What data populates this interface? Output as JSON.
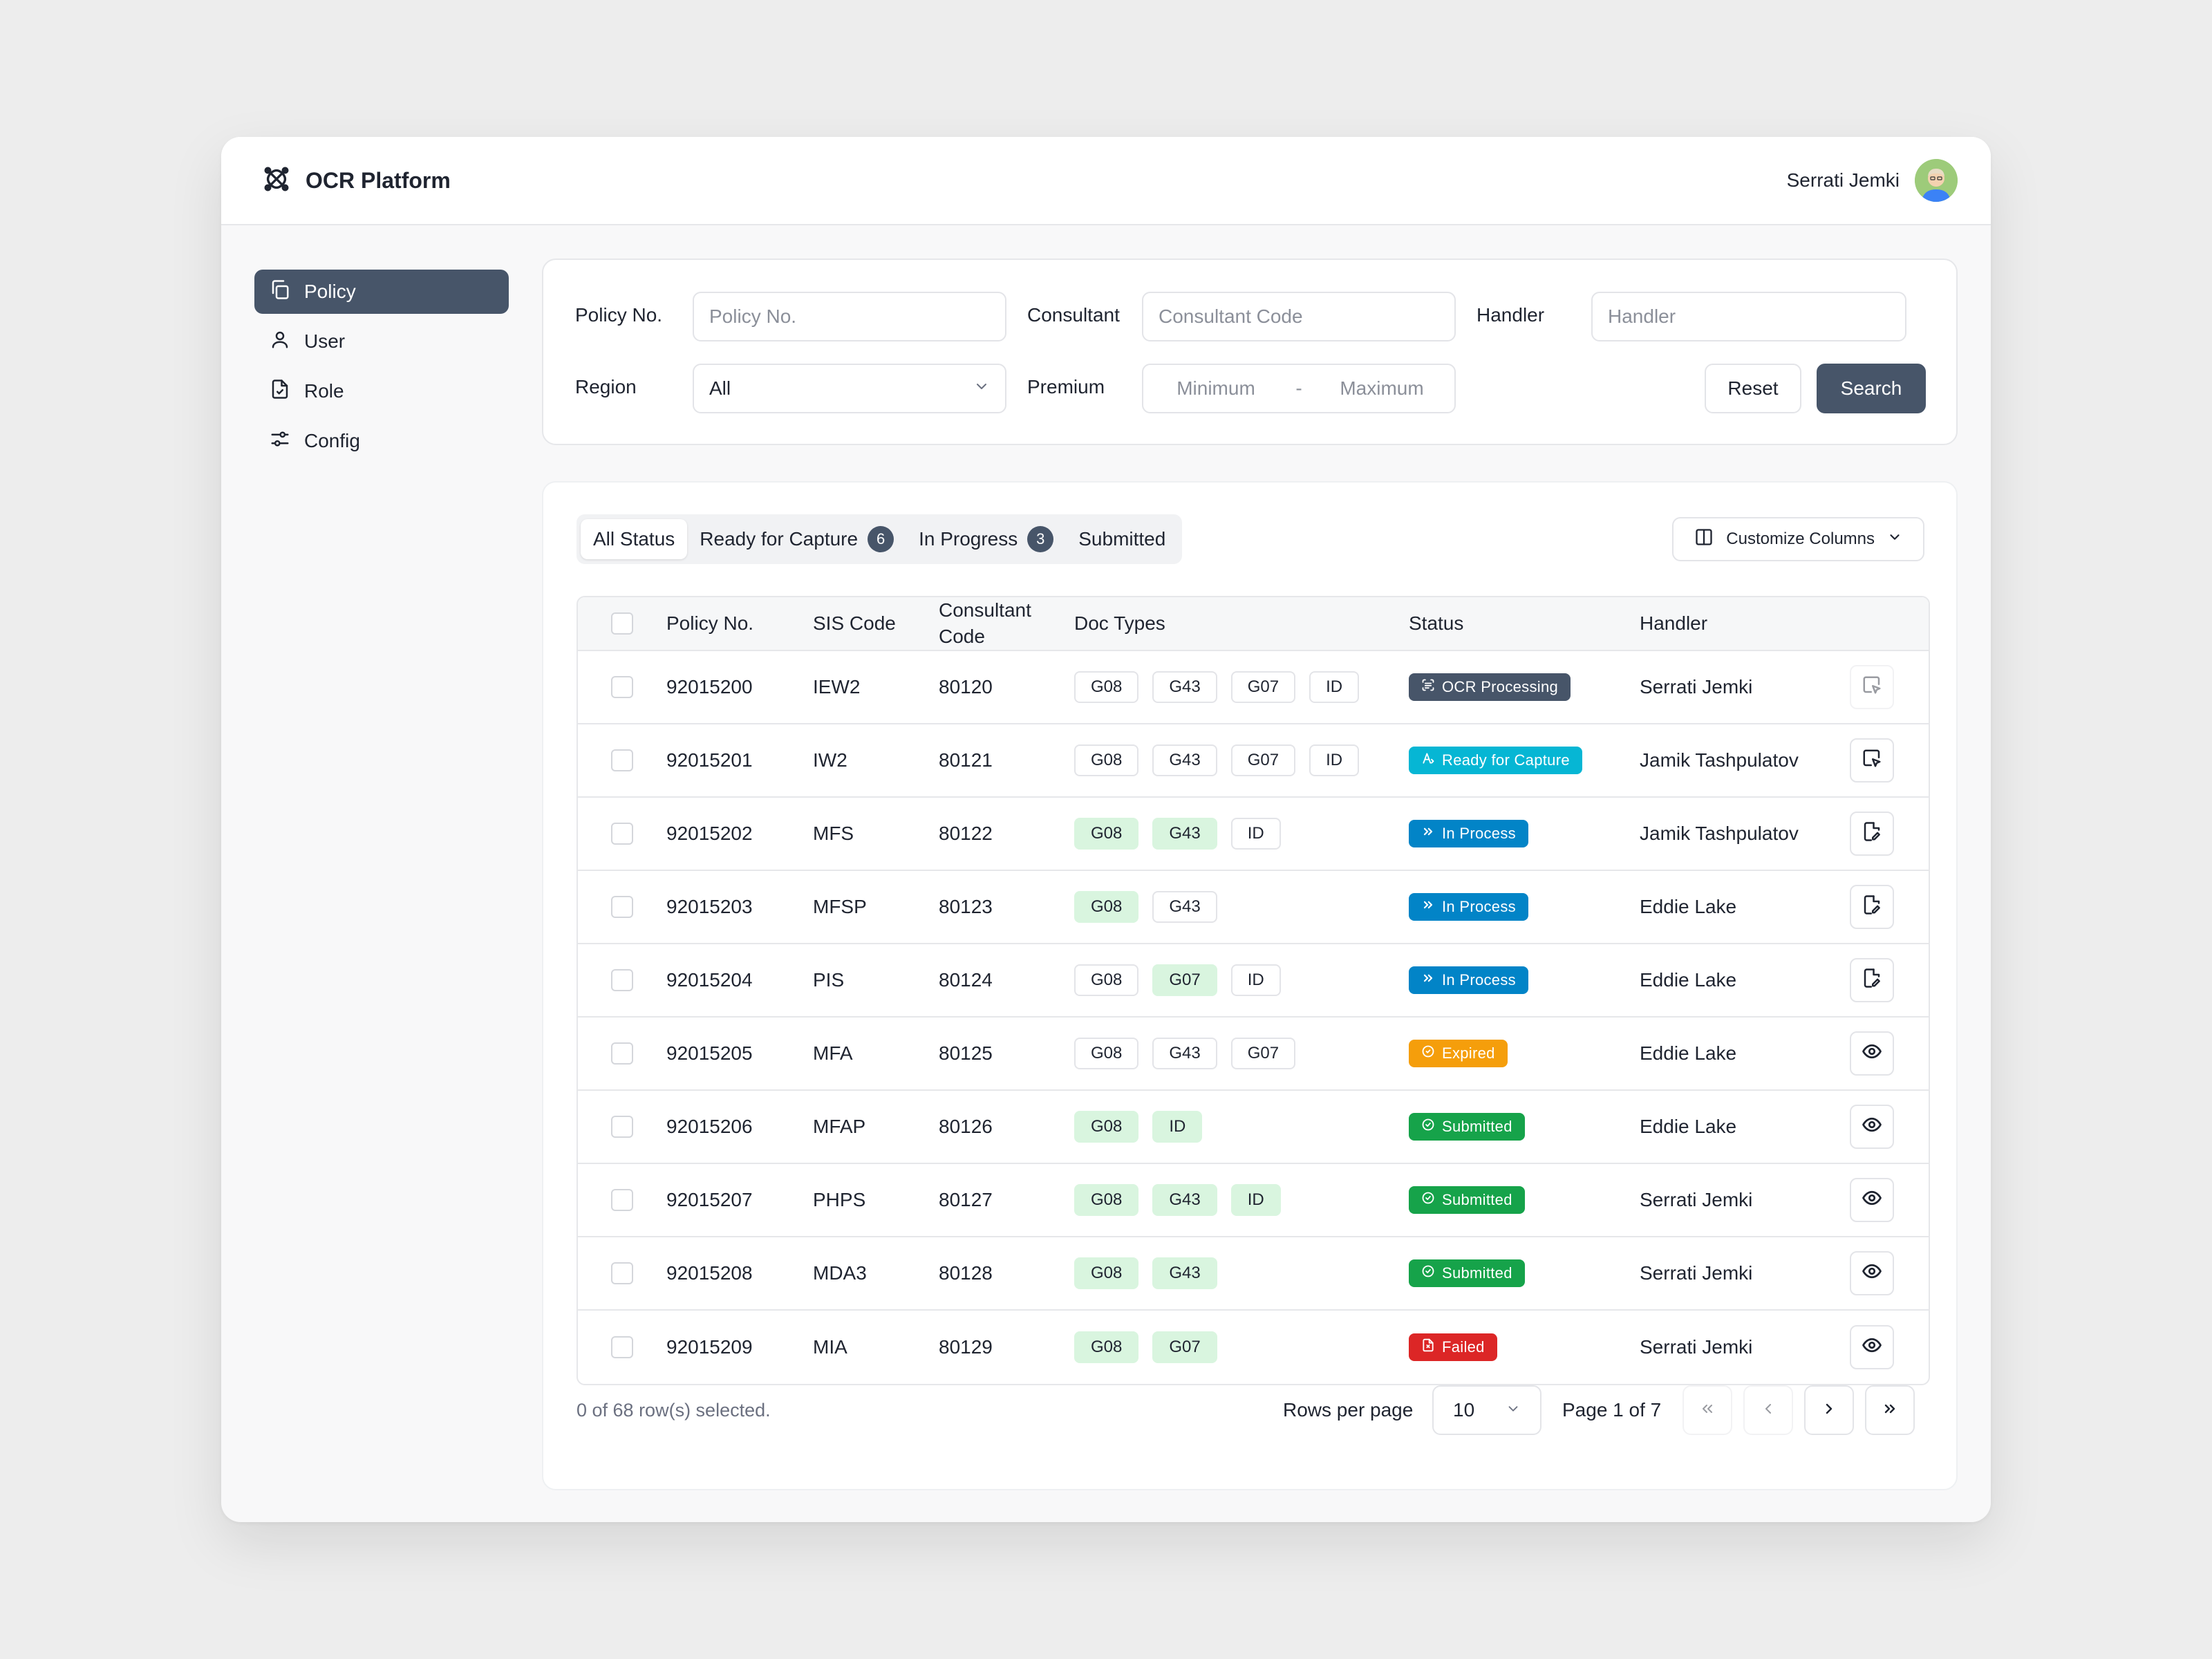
{
  "app": {
    "title": "OCR Platform"
  },
  "user": {
    "name": "Serrati Jemki"
  },
  "sidebar": {
    "items": [
      {
        "label": "Policy",
        "icon": "copy-icon",
        "active": true
      },
      {
        "label": "User",
        "icon": "user-icon",
        "active": false
      },
      {
        "label": "Role",
        "icon": "file-check-icon",
        "active": false
      },
      {
        "label": "Config",
        "icon": "sliders-icon",
        "active": false
      }
    ]
  },
  "filters": {
    "policy_label": "Policy No.",
    "policy_placeholder": "Policy No.",
    "consultant_label": "Consultant",
    "consultant_placeholder": "Consultant Code",
    "handler_label": "Handler",
    "handler_placeholder": "Handler",
    "region_label": "Region",
    "region_value": "All",
    "premium_label": "Premium",
    "premium_min_placeholder": "Minimum",
    "premium_separator": "-",
    "premium_max_placeholder": "Maximum",
    "reset_label": "Reset",
    "search_label": "Search"
  },
  "tabs": [
    {
      "label": "All Status",
      "count": null,
      "active": true
    },
    {
      "label": "Ready for Capture",
      "count": "6",
      "active": false
    },
    {
      "label": "In Progress",
      "count": "3",
      "active": false
    },
    {
      "label": "Submitted",
      "count": null,
      "active": false
    }
  ],
  "customize_columns_label": "Customize Columns",
  "table": {
    "headers": {
      "policy_no": "Policy No.",
      "sis_code": "SIS Code",
      "consultant_code": "Consultant Code",
      "doc_types": "Doc Types",
      "status": "Status",
      "handler": "Handler"
    },
    "rows": [
      {
        "policy_no": "92015200",
        "sis_code": "IEW2",
        "consultant_code": "80120",
        "docs": [
          {
            "label": "G08",
            "done": false
          },
          {
            "label": "G43",
            "done": false
          },
          {
            "label": "G07",
            "done": false
          },
          {
            "label": "ID",
            "done": false
          }
        ],
        "status": "OCR Processing",
        "status_kind": "ocr",
        "status_icon": "scan-icon",
        "handler": "Serrati Jemki",
        "action": "capture-icon",
        "action_disabled": true
      },
      {
        "policy_no": "92015201",
        "sis_code": "IW2",
        "consultant_code": "80121",
        "docs": [
          {
            "label": "G08",
            "done": false
          },
          {
            "label": "G43",
            "done": false
          },
          {
            "label": "G07",
            "done": false
          },
          {
            "label": "ID",
            "done": false
          }
        ],
        "status": "Ready for Capture",
        "status_kind": "ready",
        "status_icon": "text-select-icon",
        "handler": "Jamik Tashpulatov",
        "action": "capture-icon",
        "action_disabled": false
      },
      {
        "policy_no": "92015202",
        "sis_code": "MFS",
        "consultant_code": "80122",
        "docs": [
          {
            "label": "G08",
            "done": true
          },
          {
            "label": "G43",
            "done": true
          },
          {
            "label": "ID",
            "done": false
          }
        ],
        "status": "In Process",
        "status_kind": "process",
        "status_icon": "chevrons-right-icon",
        "handler": "Jamik Tashpulatov",
        "action": "edit-icon",
        "action_disabled": false
      },
      {
        "policy_no": "92015203",
        "sis_code": "MFSP",
        "consultant_code": "80123",
        "docs": [
          {
            "label": "G08",
            "done": true
          },
          {
            "label": "G43",
            "done": false
          }
        ],
        "status": "In Process",
        "status_kind": "process",
        "status_icon": "chevrons-right-icon",
        "handler": "Eddie Lake",
        "action": "edit-icon",
        "action_disabled": false
      },
      {
        "policy_no": "92015204",
        "sis_code": "PIS",
        "consultant_code": "80124",
        "docs": [
          {
            "label": "G08",
            "done": false
          },
          {
            "label": "G07",
            "done": true
          },
          {
            "label": "ID",
            "done": false
          }
        ],
        "status": "In Process",
        "status_kind": "process",
        "status_icon": "chevrons-right-icon",
        "handler": "Eddie Lake",
        "action": "edit-icon",
        "action_disabled": false
      },
      {
        "policy_no": "92015205",
        "sis_code": "MFA",
        "consultant_code": "80125",
        "docs": [
          {
            "label": "G08",
            "done": false
          },
          {
            "label": "G43",
            "done": false
          },
          {
            "label": "G07",
            "done": false
          }
        ],
        "status": "Expired",
        "status_kind": "expired",
        "status_icon": "clock-icon",
        "handler": "Eddie Lake",
        "action": "eye-icon",
        "action_disabled": false
      },
      {
        "policy_no": "92015206",
        "sis_code": "MFAP",
        "consultant_code": "80126",
        "docs": [
          {
            "label": "G08",
            "done": true
          },
          {
            "label": "ID",
            "done": true
          }
        ],
        "status": "Submitted",
        "status_kind": "submitted",
        "status_icon": "check-circle-icon",
        "handler": "Eddie Lake",
        "action": "eye-icon",
        "action_disabled": false
      },
      {
        "policy_no": "92015207",
        "sis_code": "PHPS",
        "consultant_code": "80127",
        "docs": [
          {
            "label": "G08",
            "done": true
          },
          {
            "label": "G43",
            "done": true
          },
          {
            "label": "ID",
            "done": true
          }
        ],
        "status": "Submitted",
        "status_kind": "submitted",
        "status_icon": "check-circle-icon",
        "handler": "Serrati Jemki",
        "action": "eye-icon",
        "action_disabled": false
      },
      {
        "policy_no": "92015208",
        "sis_code": "MDA3",
        "consultant_code": "80128",
        "docs": [
          {
            "label": "G08",
            "done": true
          },
          {
            "label": "G43",
            "done": true
          }
        ],
        "status": "Submitted",
        "status_kind": "submitted",
        "status_icon": "check-circle-icon",
        "handler": "Serrati Jemki",
        "action": "eye-icon",
        "action_disabled": false
      },
      {
        "policy_no": "92015209",
        "sis_code": "MIA",
        "consultant_code": "80129",
        "docs": [
          {
            "label": "G08",
            "done": true
          },
          {
            "label": "G07",
            "done": true
          }
        ],
        "status": "Failed",
        "status_kind": "failed",
        "status_icon": "file-x-icon",
        "handler": "Serrati Jemki",
        "action": "eye-icon",
        "action_disabled": false
      }
    ]
  },
  "footer": {
    "selection_text": "0 of 68 row(s) selected.",
    "rows_per_page_label": "Rows per page",
    "rows_per_page_value": "10",
    "page_label": "Page 1 of 7"
  },
  "colors": {
    "primary": "#475569",
    "ready": "#06b6d4",
    "process": "#0284c7",
    "expired": "#f59e0b",
    "submitted": "#16a34a",
    "failed": "#dc2626",
    "doc_done": "#d9f5df"
  }
}
